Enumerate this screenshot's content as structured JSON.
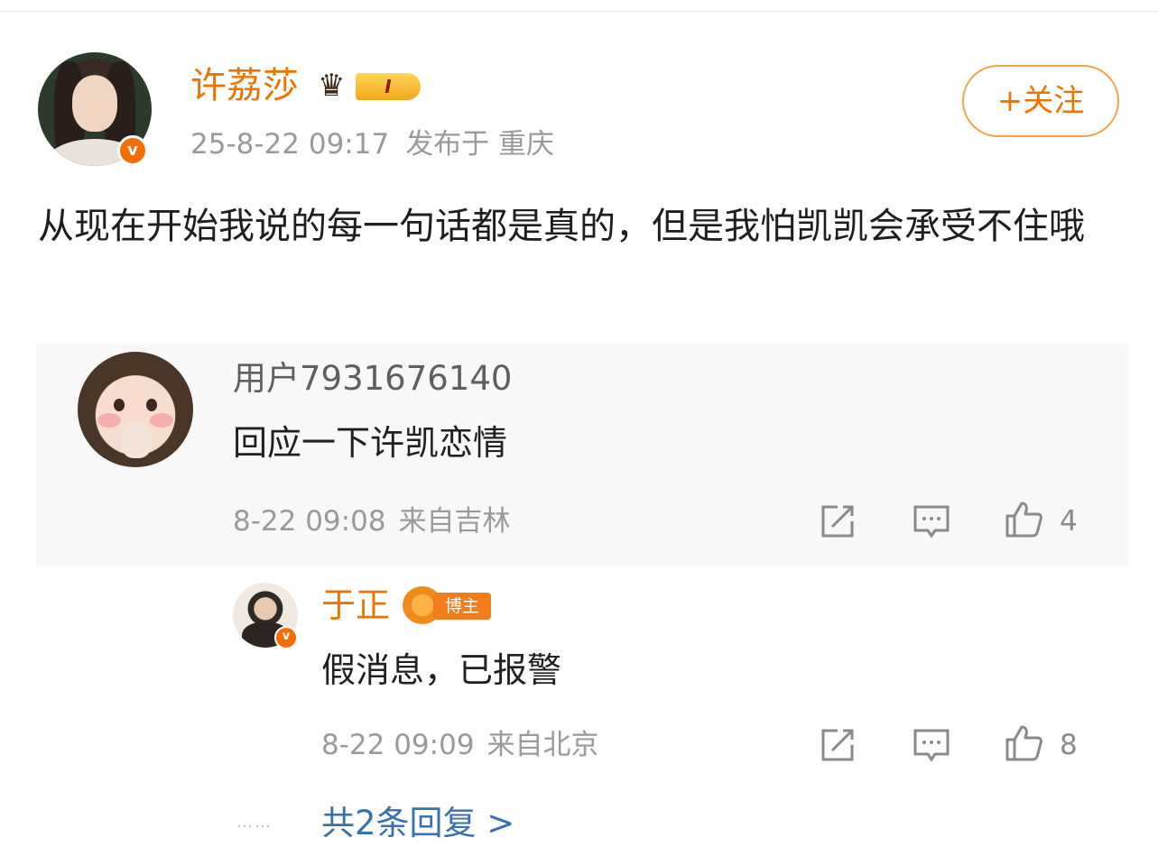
{
  "author": {
    "name": "许荔莎",
    "vip_level": "I",
    "verified_mark": "v",
    "date": "25-8-22 09:17",
    "location": "发布于 重庆",
    "follow_label": "+关注"
  },
  "post": {
    "text": "从现在开始我说的每一句话都是真的，但是我怕凯凯会承受不住哦"
  },
  "comment": {
    "user": "用户7931676140",
    "text": "回应一下许凯恋情",
    "date": "8-22 09:08",
    "location": "来自吉林",
    "like_count": "4"
  },
  "reply": {
    "user": "于正",
    "badge_label": "博主",
    "verified_mark": "v",
    "text": "假消息，已报警",
    "date": "8-22 09:09",
    "location": "来自北京",
    "like_count": "8"
  },
  "more_replies": {
    "dots": "……",
    "label": "共2条回复 >"
  },
  "colors": {
    "accent": "#eb7500",
    "verified": "#f46d08",
    "link": "#3a6fb0",
    "meta": "#9a9a9a"
  },
  "icons": [
    "share-icon",
    "comment-icon",
    "like-icon"
  ]
}
